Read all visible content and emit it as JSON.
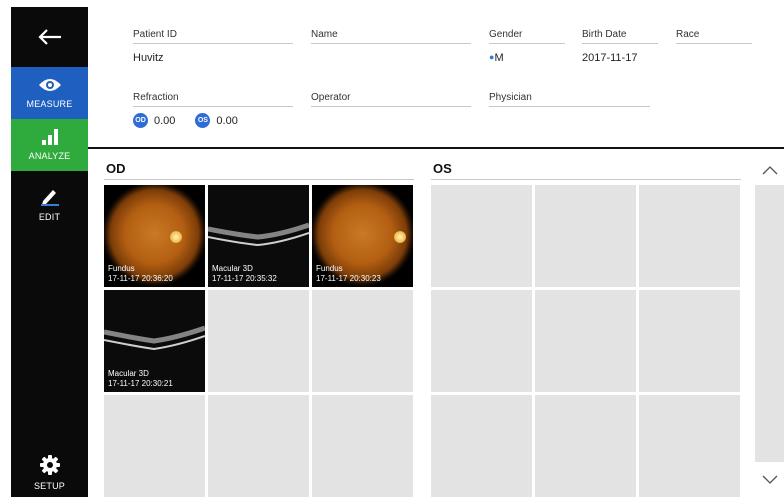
{
  "sidebar": {
    "back_icon": "arrow-left-icon",
    "items": [
      {
        "label": "MEASURE",
        "icon": "eye-icon",
        "color": "#1f5fc0"
      },
      {
        "label": "ANALYZE",
        "icon": "bar-chart-icon",
        "color": "#2faa3c"
      },
      {
        "label": "EDIT",
        "icon": "pen-icon"
      },
      {
        "label": "SETUP",
        "icon": "gear-icon"
      }
    ]
  },
  "patient": {
    "patient_id": {
      "label": "Patient ID",
      "value": "Huvitz"
    },
    "name": {
      "label": "Name",
      "value": ""
    },
    "gender": {
      "label": "Gender",
      "value": "M"
    },
    "birth_date": {
      "label": "Birth Date",
      "value": "2017-11-17"
    },
    "race": {
      "label": "Race",
      "value": ""
    },
    "refraction": {
      "label": "Refraction",
      "od_badge": "OD",
      "od_value": "0.00",
      "os_badge": "OS",
      "os_value": "0.00"
    },
    "operator": {
      "label": "Operator",
      "value": ""
    },
    "physician": {
      "label": "Physician",
      "value": ""
    }
  },
  "panels": {
    "od": {
      "title": "OD",
      "exams": [
        {
          "type": "Fundus",
          "datetime": "17-11-17 20:36:20",
          "thumb": "fundus"
        },
        {
          "type": "Macular 3D",
          "datetime": "17-11-17 20:35:32",
          "thumb": "oct"
        },
        {
          "type": "Fundus",
          "datetime": "17-11-17 20:30:23",
          "thumb": "fundus"
        },
        {
          "type": "Macular 3D",
          "datetime": "17-11-17 20:30:21",
          "thumb": "oct"
        }
      ]
    },
    "os": {
      "title": "OS",
      "exams": []
    }
  },
  "scroll": {
    "up_icon": "chevron-up-icon",
    "down_icon": "chevron-down-icon"
  }
}
